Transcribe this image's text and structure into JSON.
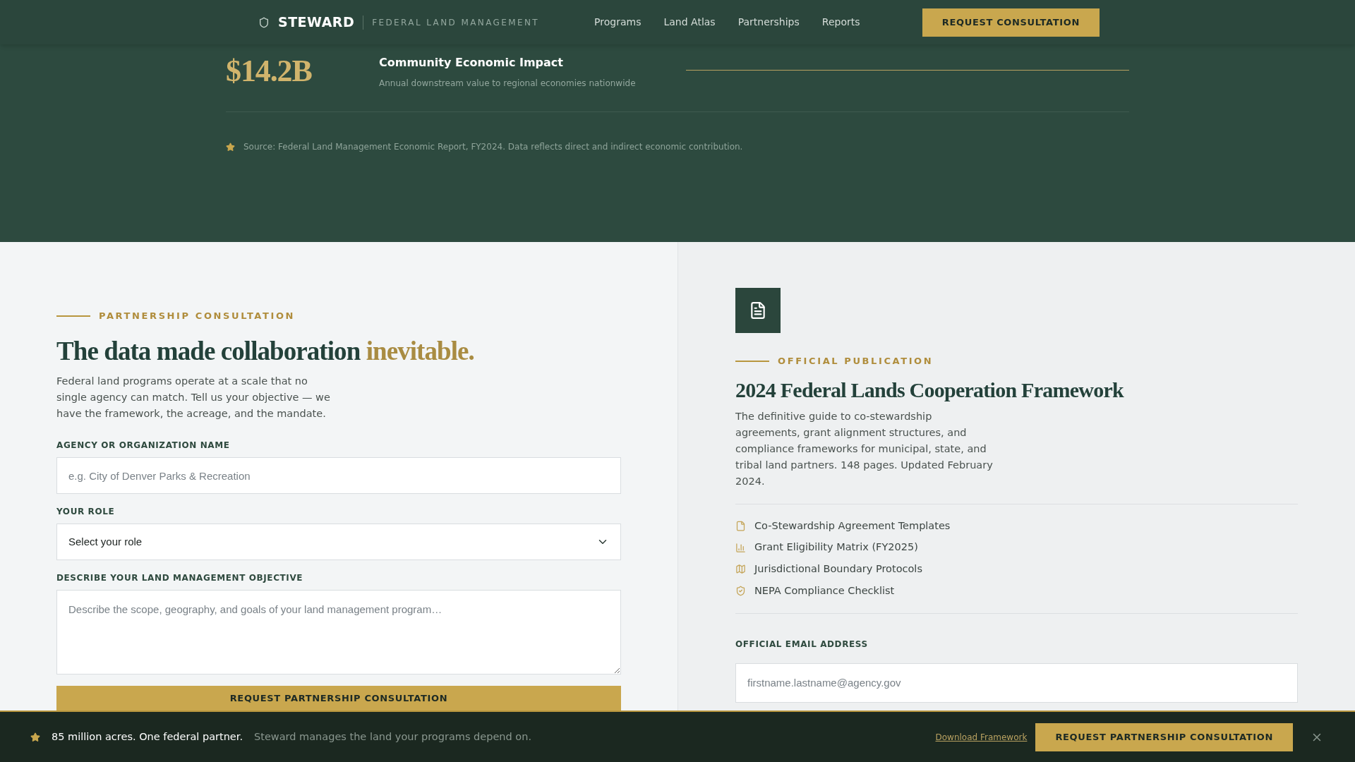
{
  "header": {
    "brand": "STEWARD",
    "tagline": "FEDERAL LAND MANAGEMENT",
    "nav": [
      {
        "label": "Programs"
      },
      {
        "label": "Land Atlas"
      },
      {
        "label": "Partnerships"
      },
      {
        "label": "Reports"
      }
    ],
    "cta": "REQUEST CONSULTATION"
  },
  "stat": {
    "value": "$14.2B",
    "title": "Community Economic Impact",
    "description": "Annual downstream value to regional economies nationwide",
    "source": "Source: Federal Land Management Economic Report, FY2024. Data reflects direct and indirect economic contribution."
  },
  "form": {
    "eyebrow": "PARTNERSHIP CONSULTATION",
    "heading": "The data made collaboration",
    "heading_accent": "inevitable.",
    "intro": "Federal land programs operate at a scale that no single agency can match. Tell us your objective — we have the framework, the acreage, and the mandate.",
    "fields": [
      {
        "kind": "text",
        "label": "AGENCY OR ORGANIZATION NAME",
        "placeholder": "e.g. City of Denver Parks & Recreation"
      },
      {
        "kind": "select",
        "label": "YOUR ROLE",
        "value": "Select your role"
      },
      {
        "kind": "textarea",
        "label": "DESCRIBE YOUR LAND MANAGEMENT OBJECTIVE",
        "placeholder": "Describe the scope, geography, and goals of your land management program…"
      }
    ],
    "submit": "REQUEST PARTNERSHIP CONSULTATION"
  },
  "publication": {
    "eyebrow": "OFFICIAL PUBLICATION",
    "title": "2024 Federal Lands Cooperation Framework",
    "description": "The definitive guide to co-stewardship agreements, grant alignment structures, and compliance frameworks for municipal, state, and tribal land partners. 148 pages. Updated February 2024.",
    "contents": [
      {
        "kind": "document",
        "label": "Co-Stewardship Agreement Templates"
      },
      {
        "kind": "chart",
        "label": "Grant Eligibility Matrix (FY2025)"
      },
      {
        "kind": "map",
        "label": "Jurisdictional Boundary Protocols"
      },
      {
        "kind": "shield",
        "label": "NEPA Compliance Checklist"
      }
    ],
    "email_label": "OFFICIAL EMAIL ADDRESS",
    "email_placeholder": "firstname.lastname@agency.gov"
  },
  "banner": {
    "headline": "85 million acres. One federal partner.",
    "text": "Steward manages the land your programs depend on.",
    "link": "Download Framework",
    "cta": "REQUEST PARTNERSHIP CONSULTATION"
  }
}
